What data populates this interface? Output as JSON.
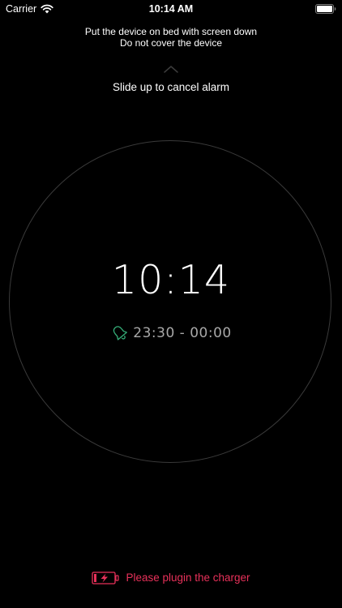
{
  "status_bar": {
    "carrier": "Carrier",
    "time": "10:14 AM",
    "wifi_icon": "wifi-icon",
    "battery_icon": "battery-icon"
  },
  "instructions": {
    "line1": "Put the device on bed with screen down",
    "line2": "Do not cover the device",
    "slide_hint": "Slide up to cancel alarm",
    "chevron_icon": "chevron-up-icon"
  },
  "clock": {
    "time": "10:14",
    "alarm_range": "23:30 - 00:00",
    "alarm_icon": "bell-icon"
  },
  "charger_warning": {
    "text": "Please plugin the charger",
    "icon": "battery-charging-icon"
  },
  "colors": {
    "background": "#000000",
    "text": "#ffffff",
    "alarm_accent": "#36b07a",
    "alarm_text": "#a8a8a8",
    "warning": "#e8315a",
    "ring": "#3a3a3a"
  }
}
